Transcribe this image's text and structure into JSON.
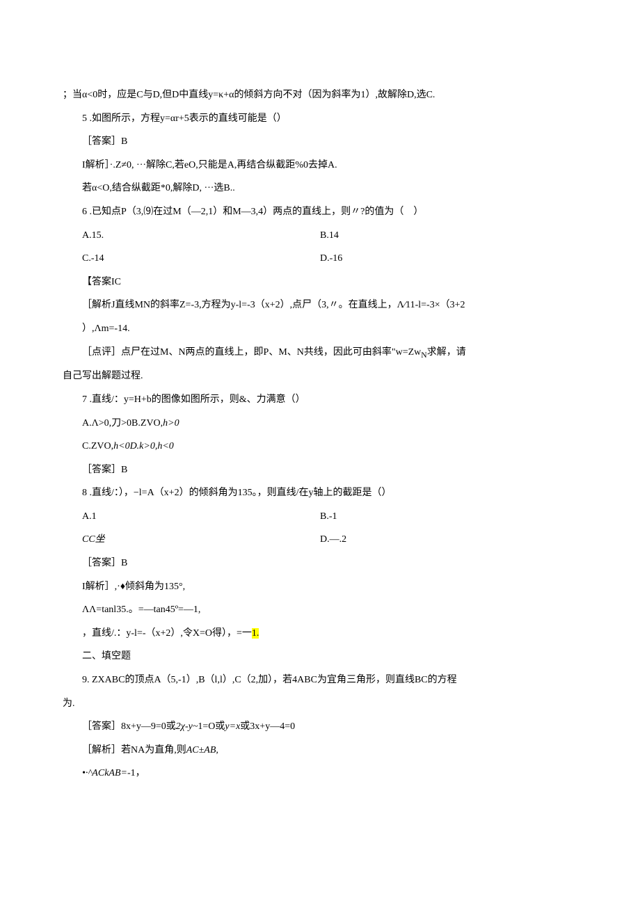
{
  "line1": "；当α<0时，应是C与D,但D中直线y=κ+α的倾斜方向不对（因为斜率为1）,故解除D,选C.",
  "q5_1": "5 .如图所示，方程y=αr+5表示的直线可能是（）",
  "q5_ans": "［答案］B",
  "q5_exp1": "I解析］·.Z≠0, ···解除C,若eO,只能是A,再结合纵截距%0去掉A.",
  "q5_exp2": "若α<O,结合纵截距*0,解除D, ···选B..",
  "q6_1": "6 .已知点P（3,⑼在过M（—2,1）和M—3,4）两点的直线上，则〃?的值为（　）",
  "q6_a": "A.15.",
  "q6_b": "B.14",
  "q6_c": "C.-14",
  "q6_d": "D.-16",
  "q6_ans": "【答案IC",
  "q6_exp1": "［解析J直线MN的斜率Z=-3,方程为y-l=-3（x+2）,点尸（3,〃。在直线上，Λ∕11-l=-3×（3+2",
  "q6_exp2": "）,Λm=-14.",
  "q6_exp3_a": "［点评］点尸在过M、N两点的直线上，即P、M、N共线，因此可由斜率\"w=Zw",
  "q6_exp3_b": "N",
  "q6_exp3_c": "求解，请",
  "q6_exp4": "自己写出解题过程.",
  "q7_1": "7 .直线/：y=H+b的图像如图所示，则&、力满意（）",
  "q7_a": "A.Λ>0,刀>0B.ZVO,",
  "q7_a_i": "h>0",
  "q7_c": "C.ZVO,",
  "q7_c_i": "h<0D.k>0,h<0",
  "q7_ans": "［答案］B",
  "q8_1": "8 .直线/：），−l=A（x+2）的倾斜角为135。，则直线/在y轴上的截距是（）",
  "q8_a": "A.1",
  "q8_b": "B.-1",
  "q8_c": "CC坐",
  "q8_d": "D.—.2",
  "q8_ans": "［答案］B",
  "q8_exp1": "I解析］,·♦倾斜角为135°,",
  "q8_exp2": "ΛΛ=tanl35.。=—tan45º=—1,",
  "q8_exp3_a": "，直线/.：y-l=-（x+2）,令X=O得），=一",
  "q8_exp3_b": "1.",
  "sec2": "二、填空题",
  "q9_1": "9. ZXABC的顶点A（5,-1）,B（l,l）,C（2,加），若4ABC为宜角三角形，则直线BC的方程",
  "q9_2": "为.",
  "q9_ans": "［答案］8x+y—9=0或",
  "q9_ans_i": "2χ-y~",
  "q9_ans_b": "1=O或",
  "q9_ans_c": "y=x",
  "q9_ans_d": "或3x+y—4=0",
  "q9_exp1": "［解析］若NA为直角,则",
  "q9_exp1_i": "AC±AB,",
  "q9_exp2_i": "•∙^ACkAB=",
  "q9_exp2_b": "-1，"
}
